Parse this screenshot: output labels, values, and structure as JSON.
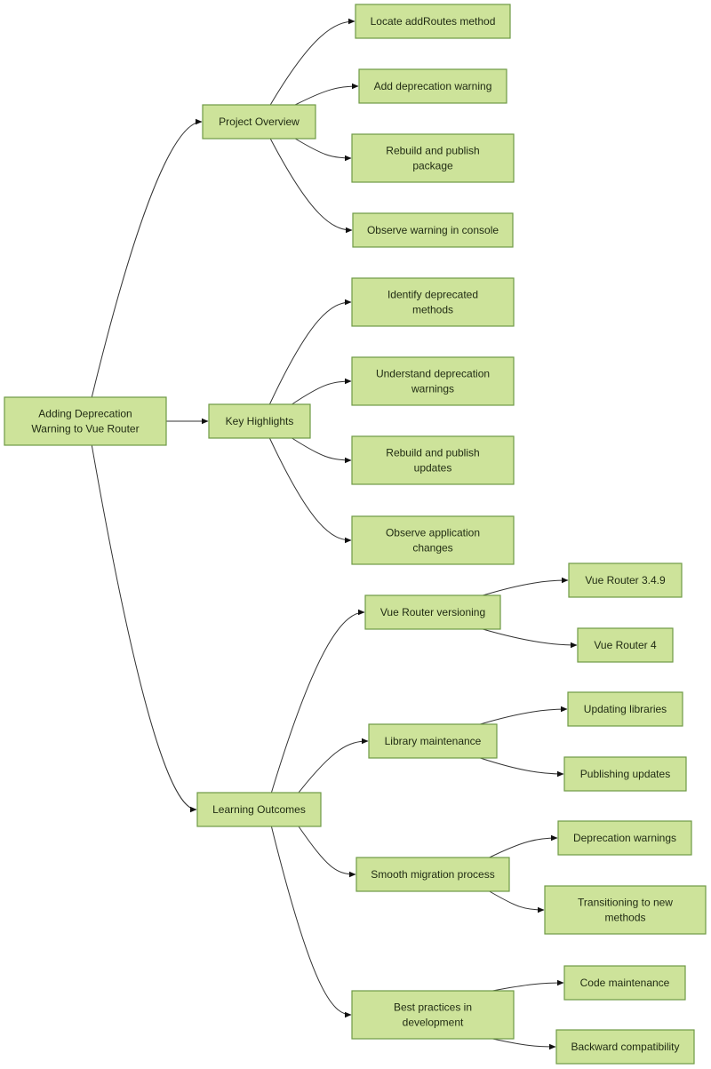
{
  "diagram": {
    "type": "mindmap",
    "root": {
      "id": "root",
      "label": [
        "Adding Deprecation",
        "Warning to Vue Router"
      ],
      "children": [
        {
          "id": "project-overview",
          "label": [
            "Project Overview"
          ],
          "children": [
            {
              "id": "locate-addroutes",
              "label": [
                "Locate addRoutes method"
              ]
            },
            {
              "id": "add-deprecation-warning",
              "label": [
                "Add deprecation warning"
              ]
            },
            {
              "id": "rebuild-publish-package",
              "label": [
                "Rebuild and publish",
                "package"
              ]
            },
            {
              "id": "observe-warning-console",
              "label": [
                "Observe warning in console"
              ]
            }
          ]
        },
        {
          "id": "key-highlights",
          "label": [
            "Key Highlights"
          ],
          "children": [
            {
              "id": "identify-deprecated",
              "label": [
                "Identify deprecated",
                "methods"
              ]
            },
            {
              "id": "understand-deprecation",
              "label": [
                "Understand deprecation",
                "warnings"
              ]
            },
            {
              "id": "rebuild-publish-updates",
              "label": [
                "Rebuild and publish",
                "updates"
              ]
            },
            {
              "id": "observe-app-changes",
              "label": [
                "Observe application",
                "changes"
              ]
            }
          ]
        },
        {
          "id": "learning-outcomes",
          "label": [
            "Learning Outcomes"
          ],
          "children": [
            {
              "id": "vue-router-versioning",
              "label": [
                "Vue Router versioning"
              ],
              "children": [
                {
                  "id": "vue-router-349",
                  "label": [
                    "Vue Router 3.4.9"
                  ]
                },
                {
                  "id": "vue-router-4",
                  "label": [
                    "Vue Router 4"
                  ]
                }
              ]
            },
            {
              "id": "library-maintenance",
              "label": [
                "Library maintenance"
              ],
              "children": [
                {
                  "id": "updating-libraries",
                  "label": [
                    "Updating libraries"
                  ]
                },
                {
                  "id": "publishing-updates",
                  "label": [
                    "Publishing updates"
                  ]
                }
              ]
            },
            {
              "id": "smooth-migration",
              "label": [
                "Smooth migration process"
              ],
              "children": [
                {
                  "id": "deprecation-warnings",
                  "label": [
                    "Deprecation warnings"
                  ]
                },
                {
                  "id": "transitioning-methods",
                  "label": [
                    "Transitioning to new",
                    "methods"
                  ]
                }
              ]
            },
            {
              "id": "best-practices",
              "label": [
                "Best practices in",
                "development"
              ],
              "children": [
                {
                  "id": "code-maintenance",
                  "label": [
                    "Code maintenance"
                  ]
                },
                {
                  "id": "backward-compatibility",
                  "label": [
                    "Backward compatibility"
                  ]
                }
              ]
            }
          ]
        }
      ]
    },
    "colors": {
      "node_fill": "#cde39a",
      "node_border": "#6f9a45",
      "edge": "#333333",
      "text": "#1f2a12"
    }
  }
}
